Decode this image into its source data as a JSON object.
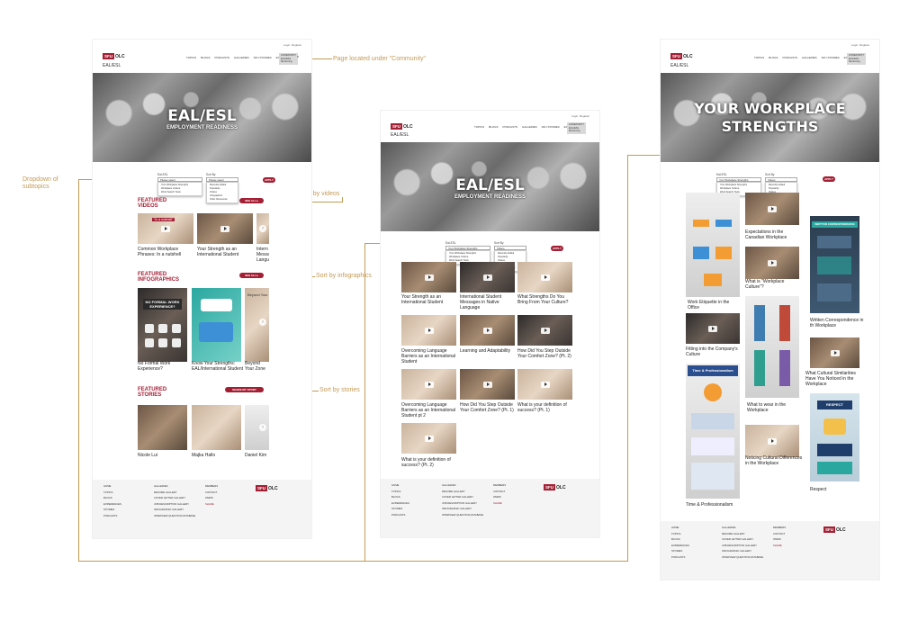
{
  "annotations": {
    "community": "Page located under \"Community\"",
    "dropdown": "Dropdown of subtopics",
    "sort_videos": "Sort by videos",
    "sort_infographics": "Sort by infographics",
    "sort_stories": "Sort by stories"
  },
  "header": {
    "login": "Login",
    "register": "Register",
    "logo_red": "SFU",
    "logo_text": "OLC",
    "nav": [
      "TOPICS",
      "BLOGS",
      "PODCASTS",
      "GALLERIES",
      "SFU STORIES",
      "EXPERIENCE"
    ],
    "community_lines": [
      "COMMUNITY",
      "EAL/ESL",
      "Mentoring"
    ],
    "page_subtitle": "EAL/ESL"
  },
  "hero": {
    "title": "EAL/ESL",
    "subtitle": "EMPLOYMENT READINESS"
  },
  "hero3": {
    "title_line1": "YOUR WORKPLACE",
    "title_line2": "STRENGTHS"
  },
  "filters": {
    "eal_label": "Eal-ESL",
    "eal_selected": "Please select",
    "eal_selected_ws": "Your Workplace Strengths",
    "eal_options": [
      "Your Workplace Strengths",
      "Workplace Culture",
      "Work Search Tools"
    ],
    "sort_label": "Sort By",
    "sort_selected": "Please select",
    "sort_selected_v": "Videos",
    "sort_options": [
      "Recently Added",
      "Popularity",
      "Videos",
      "Infographics",
      "Other Resources"
    ],
    "apply": "APPLY"
  },
  "sections": {
    "videos": "FEATURED VIDEOS",
    "infographics": "FEATURED INFOGRAPHICS",
    "stories": "FEATURED STORIES",
    "see_all": "SEE ALL ▸",
    "share": "SHARE MY STORY"
  },
  "page1": {
    "videos": [
      "Common Workplace Phrases: In a nutshell",
      "Your Strength as an International Student",
      "Intern Messa Langu"
    ],
    "video_overlay": "\"In a nutshell\"",
    "infographics": [
      "No Formal Work Experience?",
      "Know Your Strengths: EAL/International Student",
      "Beyond Your Zone"
    ],
    "infog_overlay1": "NO FORMAL WORK EXPERIENCE?",
    "infog_overlay2": "Beyond Your",
    "stories": [
      "Nicole Lui",
      "Majka Hallo",
      "Daniel Kim"
    ]
  },
  "page2": {
    "items": [
      "Your Strength as an International Student",
      "International Student Messages in Native Language",
      "What Strengths Do You Bring From Your Culture?",
      "Overcoming Language Barriers as an International Student",
      "Learning and Adaptability",
      "How Did You Step Outside Your Comfort Zone? (Pt. 2)",
      "Overcoming Language Barriers as an International Student pt 2",
      "How Did You Step Outside Your Comfort Zone? (Pt. 1)",
      "What is your definition of success? (Pt. 1)",
      "What is your definition of success? (Pt. 2)"
    ]
  },
  "page3": {
    "col1": [
      "Work Etiquette in the Office",
      "Fitting into the Company's Culture",
      "Time & Professionalism"
    ],
    "col2": [
      "Expectations in the Canadian Workplace",
      "What is \"Workplace Culture\"?",
      "What to wear in the Workplace",
      "Noticing Cultural Differences in the Workplace"
    ],
    "col3": [
      "Written Correspondence in th Workplace",
      "What Cultural Similarities Have You Noticed in the Workplace",
      "Respect"
    ],
    "overlay_time": "Time & Professionalism",
    "overlay_respect": "RESPECT",
    "overlay_written": "WRITTEN CORRESPONDENCE"
  },
  "footer": {
    "col1": [
      "HOME",
      "TOPICS",
      "BLOGS",
      "EXPERIENCES",
      "STORIES",
      "PODCASTS"
    ],
    "col2": [
      "GALLERIES",
      "RESUME GALLERY",
      "COVER LETTER GALLERY",
      "JOB DESCRIPTION GALLERY",
      "INFOGRAPHIC GALLERY",
      "INTERVIEW QUESTION DATABASE"
    ],
    "col3": [
      "MEMBERS",
      "CONTACT",
      "OMMS"
    ],
    "col3_red": "SHARE"
  },
  "colors": {
    "brand": "#a31f34",
    "annotation": "#c49a54",
    "footer_bg": "#f4f4f4"
  }
}
